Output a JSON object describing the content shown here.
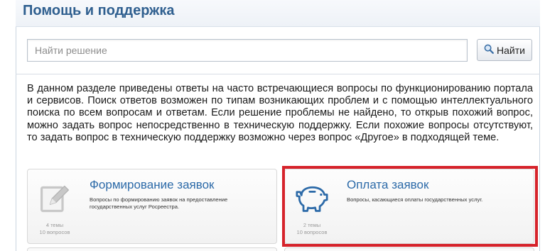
{
  "header": {
    "title": "Помощь и поддержка"
  },
  "search": {
    "placeholder": "Найти решение",
    "value": "",
    "button_label": "Найти"
  },
  "description": "В данном разделе приведены ответы на часто встречающиеся вопросы по функционированию портала и сервисов. Поиск ответов возможен по типам возникающих проблем и с помощью интеллектуального поиска по всем вопросам и ответам. Если решение проблемы не найдено, то открыв похожий вопрос, можно задать вопрос непосредственно в техническую поддержку. Если похожие вопросы отсутствуют, то задать вопрос в техническую поддержку возможно через вопрос «Другое» в подходящей теме.",
  "categories": [
    {
      "title": "Формирование заявок",
      "description": "Вопросы по формированию заявок на предоставление государственных услуг Росреестра.",
      "topics": "4 темы",
      "questions": "10 вопросов",
      "icon": "edit-document-icon",
      "icon_color": "#c8c8c8"
    },
    {
      "title": "Оплата заявок",
      "description": "Вопросы, касающиеся оплаты государственных услуг.",
      "topics": "2 темы",
      "questions": "10 вопросов",
      "icon": "piggy-bank-icon",
      "icon_color": "#2c6aa8"
    }
  ],
  "colors": {
    "header_text": "#2f5f8f",
    "link": "#2c6aa8",
    "highlight": "#d6232b"
  }
}
